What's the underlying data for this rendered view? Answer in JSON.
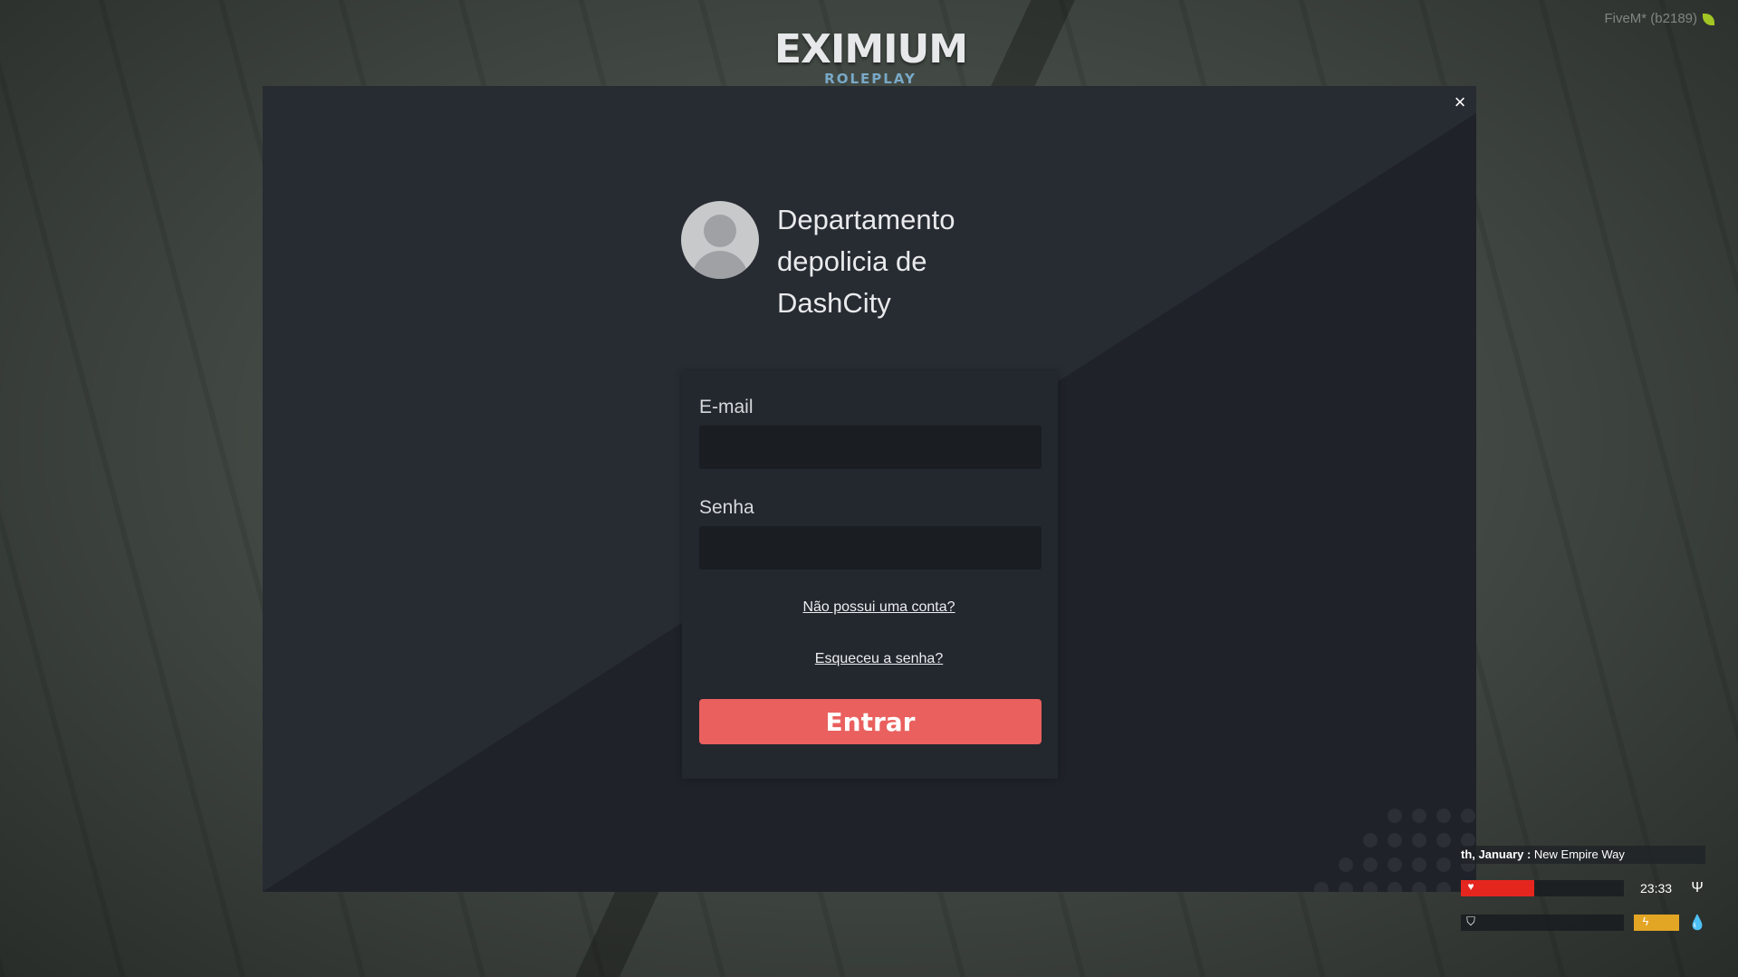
{
  "header": {
    "logo_main": "EXIMIUM",
    "logo_sub": "ROLEPLAY",
    "client_version": "FiveM* (b2189)"
  },
  "login": {
    "organization": "Departamento depolicia de DashCity",
    "email_label": "E-mail",
    "email_value": "",
    "password_label": "Senha",
    "password_value": "",
    "register_link": "Não possui uma conta?",
    "forgot_link": "Esqueceu a senha?",
    "submit_label": "Entrar",
    "close_icon": "×",
    "colors": {
      "submit": "#e9605e",
      "modal": "#272b32",
      "panel": "#23272e"
    }
  },
  "hud": {
    "date_text": "th, January :",
    "street": "New Empire Way",
    "time": "23:33",
    "health_level": 0.45,
    "energy_level": 1.0,
    "colors": {
      "health": "#e5261f",
      "energy": "#e3a524"
    },
    "icons": [
      "heart-icon",
      "shield-icon",
      "food-icon",
      "energy-icon",
      "water-icon"
    ]
  }
}
